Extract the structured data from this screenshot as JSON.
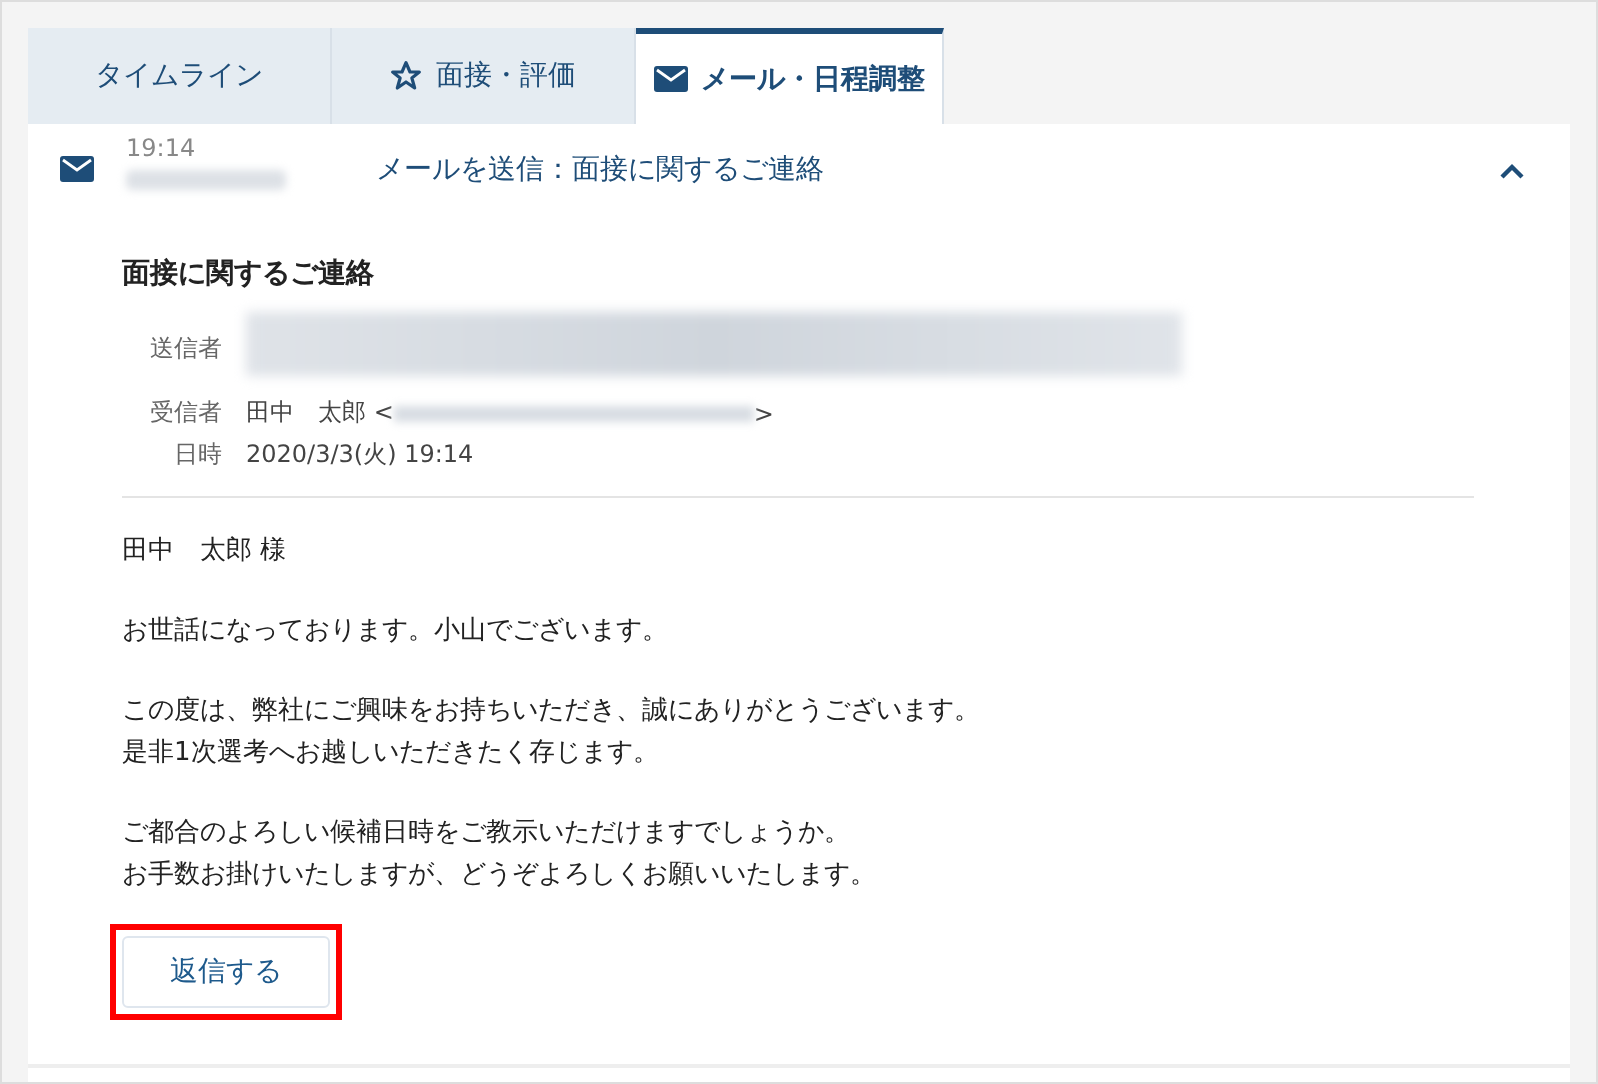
{
  "tabs": [
    {
      "label": "タイムライン",
      "kind": "plain",
      "selected": false
    },
    {
      "label": "面接・評価",
      "kind": "star",
      "selected": false
    },
    {
      "label": "メール・日程調整",
      "kind": "mail",
      "selected": true
    }
  ],
  "entry": {
    "time": "19:14",
    "summary": "メールを送信：面接に関するご連絡",
    "expanded": true,
    "subject": "面接に関するご連絡",
    "fields": [
      {
        "label": "送信者",
        "kind": "redacted-block"
      },
      {
        "label": "受信者",
        "kind": "recipient",
        "name": "田中　太郎 <",
        "suffix": ">"
      },
      {
        "label": "日時",
        "kind": "text",
        "value": "2020/3/3(火) 19:14"
      }
    ],
    "body": [
      [
        "田中　太郎 様"
      ],
      [
        "お世話になっております。小山でございます。"
      ],
      [
        "この度は、弊社にご興味をお持ちいただき、誠にありがとうございます。",
        "是非1次選考へお越しいただきたく存じます。"
      ],
      [
        "ご都合のよろしい候補日時をご教示いただけますでしょうか。",
        "お手数お掛けいたしますが、どうぞよろしくお願いいたします。"
      ]
    ],
    "reply_button": {
      "label": "返信する",
      "highlighted": true
    }
  }
}
